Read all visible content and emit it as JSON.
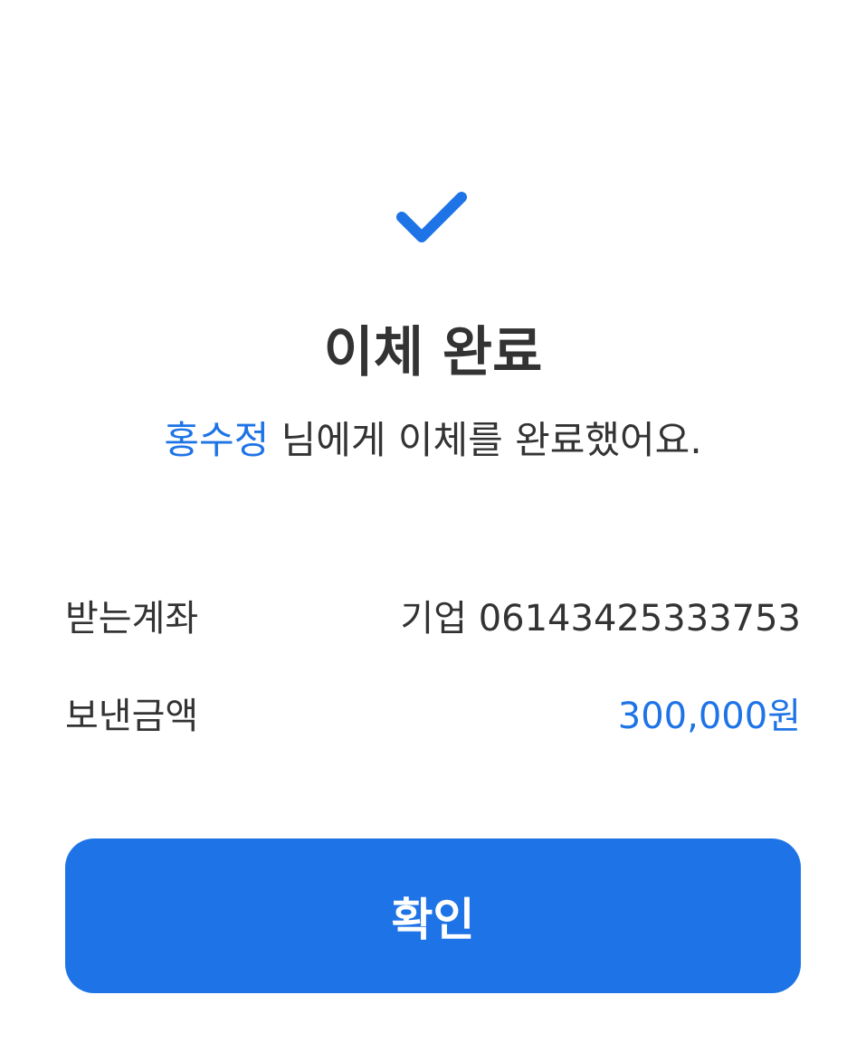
{
  "icon": {
    "name": "check-icon",
    "color": "#1e74e6"
  },
  "title": "이체 완료",
  "subtitle": {
    "recipient": "홍수정",
    "message": " 님에게 이체를 완료했어요."
  },
  "details": {
    "account_label": "받는계좌",
    "account_value": "기업 06143425333753",
    "amount_label": "보낸금액",
    "amount_value": "300,000원"
  },
  "confirm_label": "확인",
  "colors": {
    "accent": "#1e74e6",
    "text": "#333333",
    "background": "#ffffff"
  }
}
